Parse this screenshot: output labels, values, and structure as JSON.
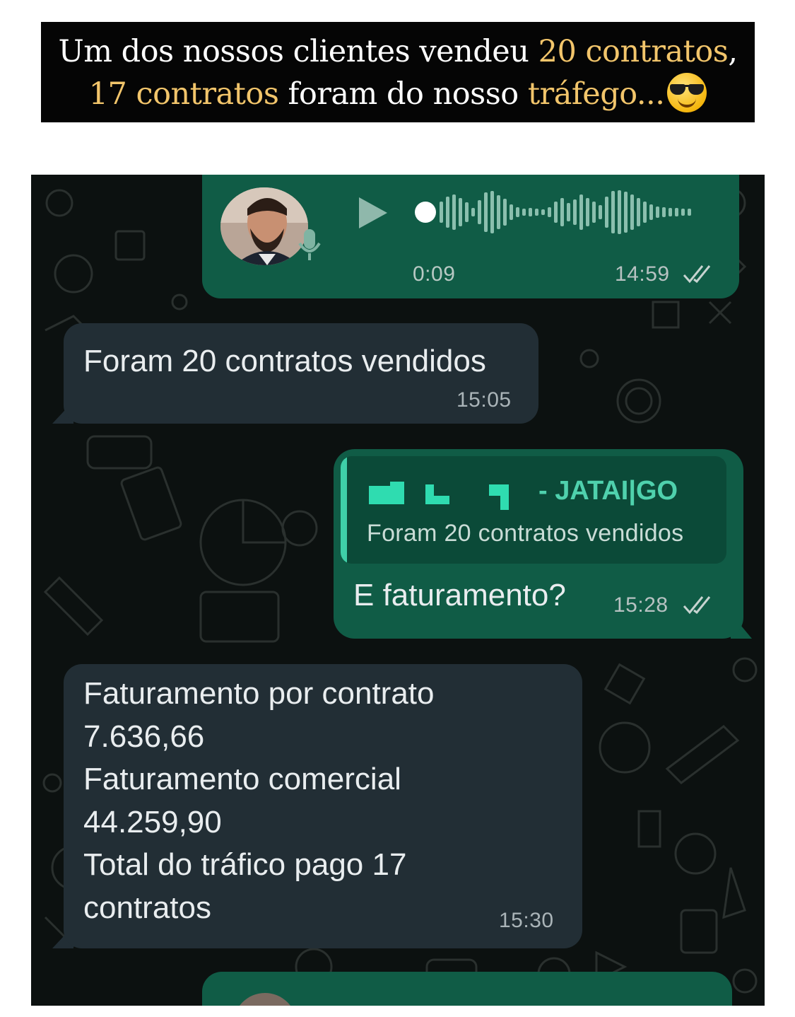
{
  "caption": {
    "line1_a": "Um dos nossos clientes vendeu ",
    "line1_b": "20 contratos",
    "line1_c": ",",
    "line2_a": "17 contratos",
    "line2_b": " foram do nosso ",
    "line2_c": "tráfego...",
    "emoji": "smiling-face-with-sunglasses-icon",
    "highlight_color": "#f2c56b"
  },
  "chat": {
    "voice_message": {
      "duration": "0:09",
      "time": "14:59",
      "status": "read"
    },
    "message_1": {
      "text": "Foram 20 contratos vendidos",
      "time": "15:05"
    },
    "reply_message": {
      "quoted_author": "- JATAI|GO",
      "quoted_text": "Foram 20 contratos vendidos",
      "text": "E faturamento?",
      "time": "15:28",
      "status": "read"
    },
    "message_3": {
      "lines": [
        "Faturamento por contrato",
        "7.636,66",
        "Faturamento comercial",
        "44.259,90",
        "Total do tráfico pago 17",
        "contratos"
      ],
      "time": "15:30"
    }
  },
  "colors": {
    "chat_background": "#0c1110",
    "incoming_bubble": "#222e35",
    "outgoing_bubble": "#105c46",
    "accent": "#4fd1ad"
  }
}
